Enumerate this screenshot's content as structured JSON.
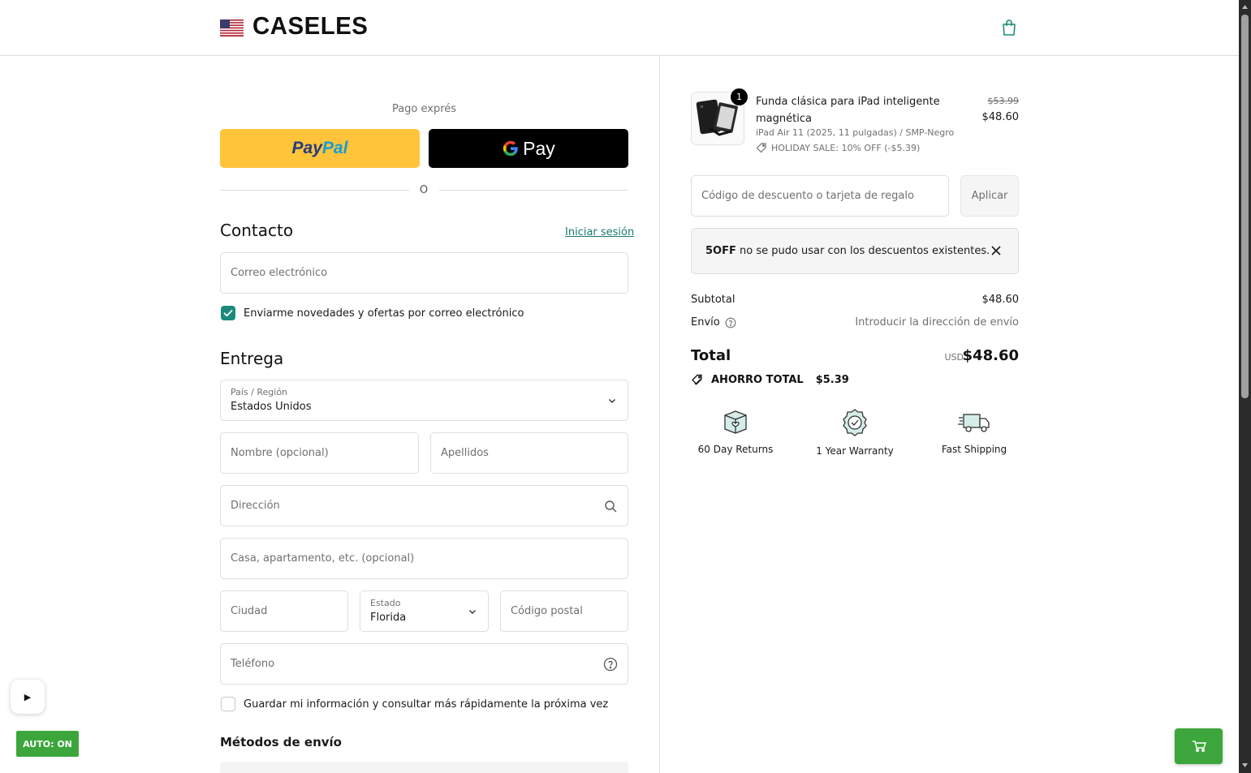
{
  "header": {
    "logo": "CASELES",
    "flag_icon": "us-flag-icon",
    "cart_icon": "shopping-bag-icon"
  },
  "express": {
    "label": "Pago exprés",
    "paypal_part1": "Pay",
    "paypal_part2": "Pal",
    "gpay_label": "Pay",
    "or": "O"
  },
  "contact": {
    "title": "Contacto",
    "login_link": "Iniciar sesión",
    "email_placeholder": "Correo electrónico",
    "newsletter_label": "Enviarme novedades y ofertas por correo electrónico",
    "newsletter_checked": true
  },
  "delivery": {
    "title": "Entrega",
    "country_label": "País / Región",
    "country_value": "Estados Unidos",
    "first_name_placeholder": "Nombre (opcional)",
    "last_name_placeholder": "Apellidos",
    "address_placeholder": "Dirección",
    "apartment_placeholder": "Casa, apartamento, etc. (opcional)",
    "city_placeholder": "Ciudad",
    "state_label": "Estado",
    "state_value": "Florida",
    "zip_placeholder": "Código postal",
    "phone_placeholder": "Teléfono",
    "save_info_label": "Guardar mi información y consultar más rápidamente la próxima vez",
    "save_info_checked": false
  },
  "shipping_methods": {
    "title": "Métodos de envío"
  },
  "order": {
    "product": {
      "quantity": "1",
      "name": "Funda clásica para iPad inteligente magnética",
      "variant": "iPad Air 11 (2025, 11 pulgadas) / SMP-Negro",
      "discount": "HOLIDAY SALE: 10% OFF (-$5.39)",
      "original_price": "$53.99",
      "price": "$48.60"
    },
    "discount_placeholder": "Código de descuento o tarjeta de regalo",
    "apply_label": "Aplicar",
    "alert_code": "5OFF",
    "alert_text": " no se pudo usar con los descuentos existentes.",
    "subtotal_label": "Subtotal",
    "subtotal_value": "$48.60",
    "shipping_label": "Envío",
    "shipping_value": "Introducir la dirección de envío",
    "total_label": "Total",
    "total_currency": "USD",
    "total_value": "$48.60",
    "savings_label": "AHORRO TOTAL",
    "savings_value": "$5.39"
  },
  "trust_badges": [
    {
      "label": "60 Day Returns",
      "icon": "return-box-icon"
    },
    {
      "label": "1 Year Warranty",
      "icon": "warranty-shield-icon"
    },
    {
      "label": "Fast Shipping",
      "icon": "delivery-truck-icon"
    }
  ],
  "overlays": {
    "play_symbol": "▶",
    "auto_label": "AUTO: ON",
    "cart_icon": "cart-icon"
  },
  "colors": {
    "accent": "#1b8a7c",
    "paypal_yellow": "#ffc439",
    "auto_green": "#3ca63c"
  }
}
